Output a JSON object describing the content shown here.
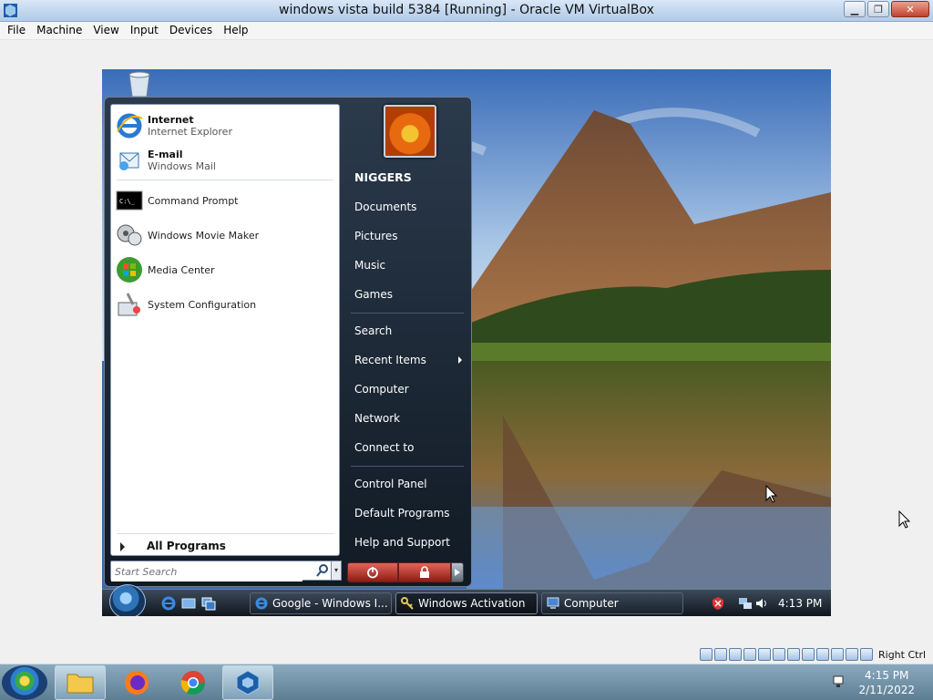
{
  "host_window": {
    "title": "windows vista build 5384 [Running] - Oracle VM VirtualBox",
    "min_label": "▁",
    "restore_label": "❐",
    "close_label": "✕"
  },
  "host_menu": [
    "File",
    "Machine",
    "View",
    "Input",
    "Devices",
    "Help"
  ],
  "start_menu": {
    "pinned": [
      {
        "title": "Internet",
        "subtitle": "Internet Explorer",
        "icon": "internet-explorer-icon"
      },
      {
        "title": "E-mail",
        "subtitle": "Windows Mail",
        "icon": "windows-mail-icon"
      }
    ],
    "recent": [
      {
        "label": "Command Prompt",
        "icon": "command-prompt-icon"
      },
      {
        "label": "Windows Movie Maker",
        "icon": "movie-maker-icon"
      },
      {
        "label": "Media Center",
        "icon": "media-center-icon"
      },
      {
        "label": "System Configuration",
        "icon": "system-configuration-icon"
      }
    ],
    "all_programs": "All Programs",
    "search_placeholder": "Start Search",
    "user_name": "NIGGERS",
    "right_items_1": [
      "Documents",
      "Pictures",
      "Music",
      "Games"
    ],
    "right_items_2": [
      "Search",
      "Recent Items",
      "Computer",
      "Network",
      "Connect to"
    ],
    "right_items_3": [
      "Control Panel",
      "Default Programs",
      "Help and Support"
    ]
  },
  "vm_taskbar": {
    "tasks": [
      {
        "label": "Google - Windows I...",
        "icon": "internet-explorer-icon",
        "active": false
      },
      {
        "label": "Windows Activation",
        "icon": "activation-key-icon",
        "active": true
      },
      {
        "label": "Computer",
        "icon": "computer-icon",
        "active": false
      }
    ],
    "clock": "4:13 PM"
  },
  "host_status": {
    "right_ctrl": "Right Ctrl"
  },
  "host_taskbar": {
    "apps": [
      "file-explorer-icon",
      "firefox-icon",
      "chrome-icon",
      "virtualbox-icon"
    ],
    "time": "4:15 PM",
    "date": "2/11/2022"
  },
  "colors": {
    "vista_dark": "#111a24",
    "accent_blue": "#2e73b8",
    "power_red": "#8e1c12"
  }
}
